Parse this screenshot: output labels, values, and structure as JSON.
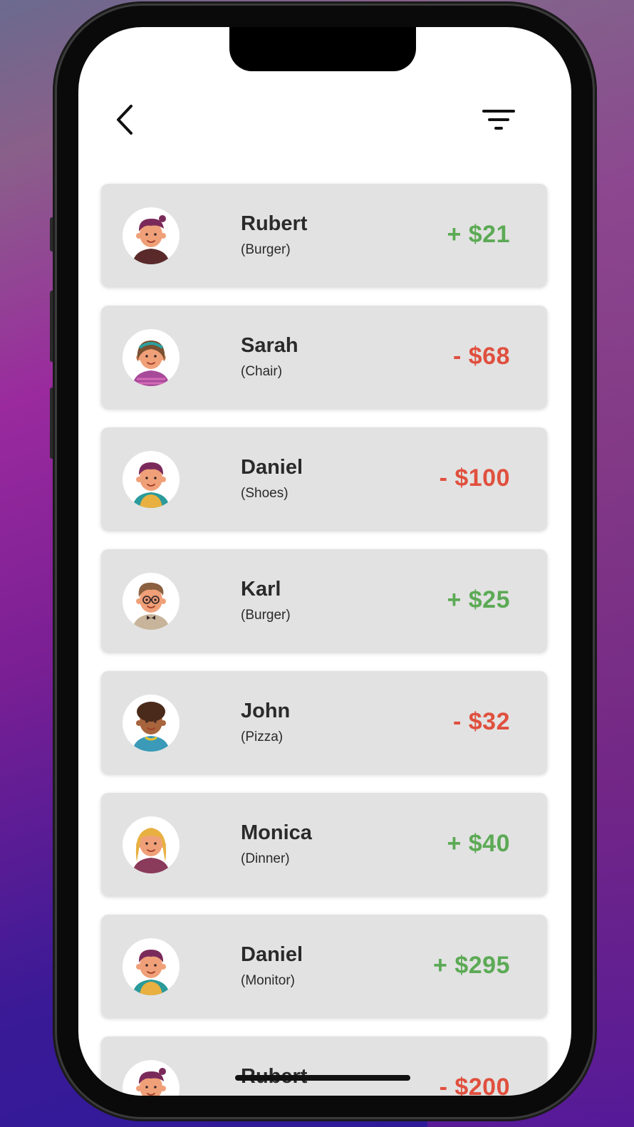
{
  "header": {
    "back_icon": "chevron-left-icon",
    "filter_icon": "filter-icon"
  },
  "colors": {
    "positive": "#5caa55",
    "negative": "#e0503e",
    "card_background": "#e2e2e2"
  },
  "transactions": [
    {
      "name": "Rubert",
      "item": "(Burger)",
      "amount": "+ $21",
      "direction": "positive",
      "avatar": "avatar-purple-hair-boy"
    },
    {
      "name": "Sarah",
      "item": "(Chair)",
      "amount": "- $68",
      "direction": "negative",
      "avatar": "avatar-girl-headband"
    },
    {
      "name": "Daniel",
      "item": "(Shoes)",
      "amount": "- $100",
      "direction": "negative",
      "avatar": "avatar-boy-yellow-shirt"
    },
    {
      "name": "Karl",
      "item": "(Burger)",
      "amount": "+ $25",
      "direction": "positive",
      "avatar": "avatar-boy-glasses"
    },
    {
      "name": "John",
      "item": "(Pizza)",
      "amount": "- $32",
      "direction": "negative",
      "avatar": "avatar-boy-curly-hair"
    },
    {
      "name": "Monica",
      "item": "(Dinner)",
      "amount": "+ $40",
      "direction": "positive",
      "avatar": "avatar-girl-blonde"
    },
    {
      "name": "Daniel",
      "item": "(Monitor)",
      "amount": "+ $295",
      "direction": "positive",
      "avatar": "avatar-boy-yellow-shirt"
    },
    {
      "name": "Rubert",
      "item": "",
      "amount": "- $200",
      "direction": "negative",
      "avatar": "avatar-purple-hair-boy"
    }
  ]
}
